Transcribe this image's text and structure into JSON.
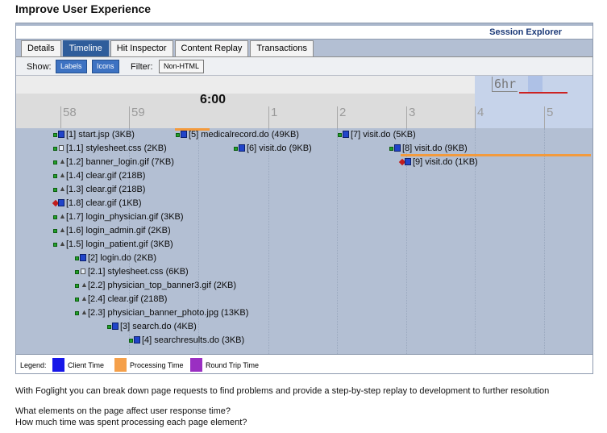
{
  "page": {
    "title": "Improve User Experience"
  },
  "explorer": {
    "title": "Session Explorer",
    "tabs": [
      {
        "label": "Details",
        "active": false
      },
      {
        "label": "Timeline",
        "active": true
      },
      {
        "label": "Hit Inspector",
        "active": false
      },
      {
        "label": "Content Replay",
        "active": false
      },
      {
        "label": "Transactions",
        "active": false
      }
    ],
    "toolbar": {
      "show_label": "Show:",
      "labels_btn": "Labels",
      "icons_btn": "Icons",
      "filter_label": "Filter:",
      "filter_btn": "Non-HTML"
    }
  },
  "timeline": {
    "hour_label": "6hr",
    "ticks": [
      "58",
      "59",
      "6:00",
      "1",
      "2",
      "3",
      "4",
      "5"
    ],
    "requests": [
      {
        "label": "[1] start.jsp (3KB)",
        "icon": "green-page"
      },
      {
        "label": "[1.1] stylesheet.css (2KB)",
        "icon": "green-style"
      },
      {
        "label": "[1.2] banner_login.gif (7KB)",
        "icon": "green-image"
      },
      {
        "label": "[1.4] clear.gif (218B)",
        "icon": "green-image"
      },
      {
        "label": "[1.3] clear.gif (218B)",
        "icon": "green-image"
      },
      {
        "label": "[1.8] clear.gif (1KB)",
        "icon": "red-page"
      },
      {
        "label": "[1.7] login_physician.gif (3KB)",
        "icon": "green-image"
      },
      {
        "label": "[1.6] login_admin.gif (2KB)",
        "icon": "green-image"
      },
      {
        "label": "[1.5] login_patient.gif (3KB)",
        "icon": "green-image"
      },
      {
        "label": "[2] login.do (2KB)",
        "icon": "green-page"
      },
      {
        "label": "[2.1] stylesheet.css (6KB)",
        "icon": "green-style"
      },
      {
        "label": "[2.2] physician_top_banner3.gif (2KB)",
        "icon": "green-image"
      },
      {
        "label": "[2.4] clear.gif (218B)",
        "icon": "green-image"
      },
      {
        "label": "[2.3] physician_banner_photo.jpg (13KB)",
        "icon": "green-image"
      },
      {
        "label": "[3] search.do (4KB)",
        "icon": "green-page"
      },
      {
        "label": "[4] searchresults.do (3KB)",
        "icon": "green-page"
      },
      {
        "label": "[5] medicalrecord.do (49KB)",
        "icon": "green-page"
      },
      {
        "label": "[6] visit.do (9KB)",
        "icon": "green-page"
      },
      {
        "label": "[7] visit.do (5KB)",
        "icon": "green-page"
      },
      {
        "label": "[8] visit.do (9KB)",
        "icon": "green-page"
      },
      {
        "label": "[9] visit.do (1KB)",
        "icon": "red-page"
      }
    ]
  },
  "legend": {
    "label": "Legend:",
    "items": [
      {
        "label": "Client Time",
        "color": "#1616e8"
      },
      {
        "label": "Processing Time",
        "color": "#f5a04a"
      },
      {
        "label": "Round Trip Time",
        "color": "#9a2fc2"
      }
    ]
  },
  "colors": {
    "processing_bar": "#f39a3c",
    "client_bar": "#2244cc"
  },
  "captions": {
    "line1": "With Foglight you can break down page requests to find problems and provide a step-by-step replay to development to further resolution",
    "line2": "What elements on the page affect user response time?",
    "line3": "How much time was spent processing each page element?"
  }
}
